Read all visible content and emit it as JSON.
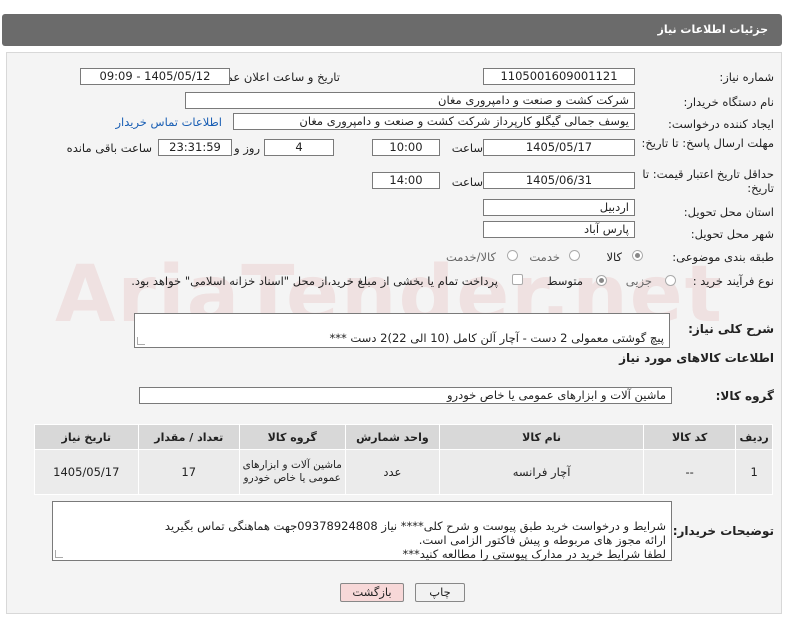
{
  "header": {
    "title": "جزئیات اطلاعات نیاز"
  },
  "form": {
    "need_number_label": "شماره نیاز:",
    "need_number": "1105001609001121",
    "announce_label": "تاریخ و ساعت اعلان عمومی:",
    "announce_value": "1405/05/12 - 09:09",
    "buyer_org_label": "نام دستگاه خریدار:",
    "buyer_org": "شرکت کشت و صنعت و دامپروری مغان",
    "creator_label": "ایجاد کننده درخواست:",
    "creator": "یوسف جمالی گیگلو کارپرداز شرکت کشت و صنعت و دامپروری مغان",
    "contact_link": "اطلاعات تماس خریدار",
    "deadline_label": "مهلت ارسال پاسخ: تا تاریخ:",
    "deadline_date": "1405/05/17",
    "time_label": "ساعت",
    "deadline_time": "10:00",
    "days_value": "4",
    "days_label": "روز و",
    "remaining_time": "23:31:59",
    "remaining_label": "ساعت باقی مانده",
    "validity_label": "حداقل تاریخ اعتبار قیمت: تا تاریخ:",
    "validity_date": "1405/06/31",
    "validity_time": "14:00",
    "province_label": "استان محل تحویل:",
    "province": "اردبیل",
    "city_label": "شهر محل تحویل:",
    "city": "پارس آباد",
    "category_label": "طبقه بندی موضوعی:",
    "category_options": [
      "کالا",
      "خدمت",
      "کالا/خدمت"
    ],
    "process_label": "نوع فرآیند خرید :",
    "process_options": [
      "جزیی",
      "متوسط"
    ],
    "payment_note": "پرداخت تمام یا بخشی از مبلغ خرید،از محل \"اسناد خزانه اسلامی\" خواهد بود.",
    "summary_label": "شرح کلی نیاز:",
    "summary": "پیچ گوشتی معمولی 2 دست - آچار آلن کامل (10 الی 22)2 دست ***",
    "goods_info_title": "اطلاعات کالاهای مورد نیاز",
    "goods_group_label": "گروه کالا:",
    "goods_group": "ماشین آلات و ابزارهای عمومی یا خاص خودرو"
  },
  "table": {
    "headers": [
      "ردیف",
      "کد کالا",
      "نام کالا",
      "واحد شمارش",
      "گروه کالا",
      "تعداد / مقدار",
      "تاریخ نیاز"
    ],
    "rows": [
      [
        "1",
        "--",
        "آچار فرانسه",
        "عدد",
        "ماشین آلات و ابزارهای عمومی یا خاص خودرو",
        "17",
        "1405/05/17"
      ]
    ]
  },
  "notes": {
    "label": "توضیحات خریدار:",
    "text": "شرایط و درخواست خرید طبق پیوست و شرح کلی**** نیاز 09378924808جهت هماهنگی تماس بگیرید\nارائه مجوز های مربوطه و پیش فاکتور الزامی است.\nلطفا شرایط خرید در مدارک پیوستی را مطالعه کنید***"
  },
  "buttons": {
    "print": "چاپ",
    "back": "بازگشت"
  },
  "watermark": "AriaTender.net"
}
